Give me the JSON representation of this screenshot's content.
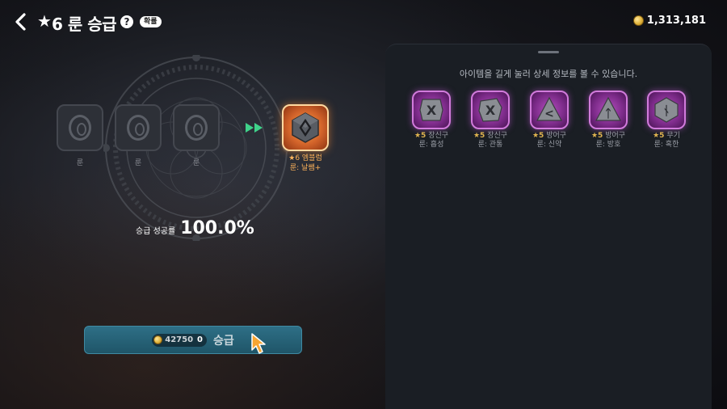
{
  "header": {
    "title_star": "★",
    "title": "6 룬 승급",
    "help_icon_glyph": "?",
    "prob_badge": "확률",
    "gold": "1,313,181"
  },
  "material_slots": [
    {
      "label": "룬"
    },
    {
      "label": "룬"
    },
    {
      "label": "룬"
    }
  ],
  "result": {
    "line1": "★6 엠블럼",
    "line2": "룬: 날쌤+"
  },
  "success": {
    "label": "승급 성공률",
    "value": "100.0%"
  },
  "upgrade_button": {
    "cost": "42750",
    "owned": "0",
    "label": "승급"
  },
  "panel": {
    "hint": "아이템을 길게 눌러 상세 정보를 볼 수 있습니다.",
    "runes": [
      {
        "stars": "★5",
        "type": "장신구",
        "name": "룬: 흡성",
        "glyph": "X"
      },
      {
        "stars": "★5",
        "type": "장신구",
        "name": "룬: 관통",
        "glyph": "X"
      },
      {
        "stars": "★5",
        "type": "방어구",
        "name": "룬: 신약",
        "glyph": "<"
      },
      {
        "stars": "★5",
        "type": "방어구",
        "name": "룬: 방호",
        "glyph": "ᛏ"
      },
      {
        "stars": "★5",
        "type": "무기",
        "name": "룬: 혹한",
        "glyph": "ᚾ"
      }
    ]
  },
  "colors": {
    "button": "#2e6f86",
    "rune_frame": "#7b2a88",
    "result_frame": "#d2632a",
    "result_text": "#ffb35a",
    "star": "#e0b450"
  }
}
